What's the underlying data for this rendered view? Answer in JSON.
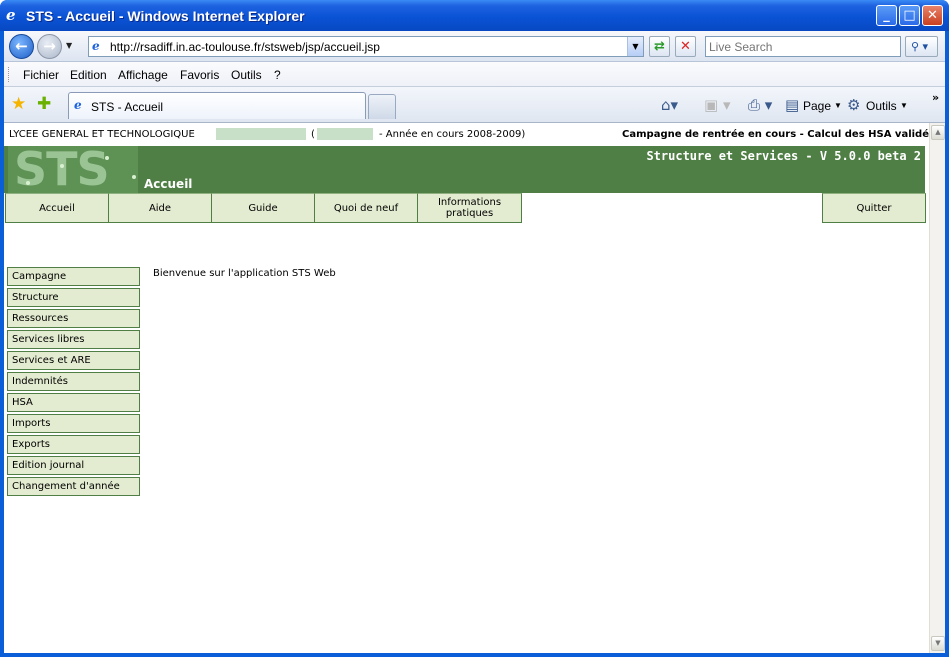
{
  "window": {
    "title": "STS - Accueil - Windows Internet Explorer"
  },
  "address": {
    "url": "http://rsadiff.in.ac-toulouse.fr/stsweb/jsp/accueil.jsp"
  },
  "search": {
    "placeholder": "Live Search"
  },
  "menubar": {
    "items": [
      "Fichier",
      "Edition",
      "Affichage",
      "Favoris",
      "Outils",
      "?"
    ]
  },
  "tabs": {
    "active_label": "STS - Accueil"
  },
  "toolbar": {
    "page_label": "Page",
    "tools_label": "Outils"
  },
  "page": {
    "lycee_label": "LYCEE GENERAL ET TECHNOLOGIQUE",
    "paren_open": "(",
    "annee_label": "- Année en cours 2008-2009)",
    "campagne_label": "Campagne de rentrée en cours - Calcul des HSA validé",
    "logo_text": "STS",
    "version": "Structure et Services - V 5.0.0 beta 2",
    "page_name": "Accueil",
    "nav": [
      "Accueil",
      "Aide",
      "Guide",
      "Quoi de neuf",
      "Informations pratiques",
      "Quitter"
    ],
    "side_menu": [
      "Campagne",
      "Structure",
      "Ressources",
      "Services libres",
      "Services et ARE",
      "Indemnités",
      "HSA",
      "Imports",
      "Exports",
      "Edition journal",
      "Changement d'année"
    ],
    "welcome": "Bienvenue sur l'application STS Web"
  }
}
